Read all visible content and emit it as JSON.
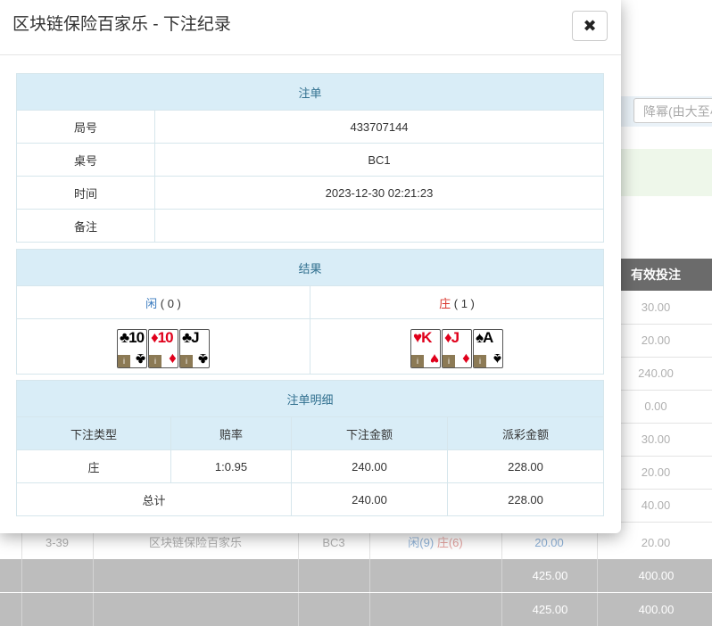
{
  "background": {
    "filter_label": ":",
    "filter_select": "降幂(由大至小)",
    "column_header": "有效投注",
    "rows": [
      {
        "v": "30.00"
      },
      {
        "v": "20.00"
      },
      {
        "v": "240.00"
      },
      {
        "v": "0.00"
      },
      {
        "v": "30.00"
      },
      {
        "v": "20.00"
      },
      {
        "v": "40.00"
      }
    ],
    "last_row": {
      "idx": "3-39",
      "game": "区块链保险百家乐",
      "table": "BC3",
      "player": "闲(9)",
      "banker": "庄(6)",
      "bet": "20.00",
      "valid": "20.00"
    },
    "totals": [
      {
        "bet": "425.00",
        "valid": "400.00"
      },
      {
        "bet": "425.00",
        "valid": "400.00"
      }
    ]
  },
  "modal": {
    "title": "区块链保险百家乐 - 下注纪录",
    "close_symbol": "✖",
    "ticket": {
      "header": "注单",
      "rows": [
        {
          "label": "局号",
          "value": "433707144"
        },
        {
          "label": "桌号",
          "value": "BC1"
        },
        {
          "label": "时间",
          "value": "2023-12-30 02:21:23"
        },
        {
          "label": "备注",
          "value": ""
        }
      ]
    },
    "result": {
      "header": "结果",
      "player_label": "闲",
      "player_score": "( 0 )",
      "banker_label": "庄",
      "banker_score": "( 1 )",
      "player_cards": [
        {
          "rank": "10",
          "suit": "♣",
          "color": "black"
        },
        {
          "rank": "10",
          "suit": "♦",
          "color": "red"
        },
        {
          "rank": "J",
          "suit": "♣",
          "color": "black"
        }
      ],
      "banker_cards": [
        {
          "rank": "K",
          "suit": "♥",
          "color": "red"
        },
        {
          "rank": "J",
          "suit": "♦",
          "color": "red"
        },
        {
          "rank": "A",
          "suit": "♠",
          "color": "black"
        }
      ],
      "card_tag": "i"
    },
    "detail": {
      "header": "注单明细",
      "columns": [
        "下注类型",
        "赔率",
        "下注金额",
        "派彩金额"
      ],
      "row": {
        "type": "庄",
        "odds": "1:0.95",
        "amount": "240.00",
        "payout": "228.00"
      },
      "total": {
        "label": "总计",
        "amount": "240.00",
        "payout": "228.00"
      }
    }
  }
}
